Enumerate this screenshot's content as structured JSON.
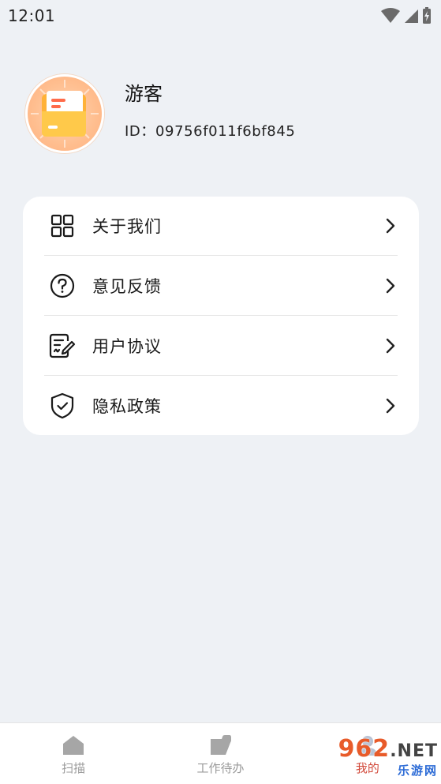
{
  "status_bar": {
    "time": "12:01"
  },
  "profile": {
    "name": "游客",
    "id_label": "ID：09756f011f6bf845"
  },
  "menu": {
    "items": [
      {
        "label": "关于我们",
        "icon": "grid-icon"
      },
      {
        "label": "意见反馈",
        "icon": "question-circle-icon"
      },
      {
        "label": "用户协议",
        "icon": "document-edit-icon"
      },
      {
        "label": "隐私政策",
        "icon": "shield-check-icon"
      }
    ]
  },
  "tab_bar": {
    "tabs": [
      {
        "label": "扫描",
        "icon": "home-icon",
        "active": false
      },
      {
        "label": "工作待办",
        "icon": "task-icon",
        "active": false
      },
      {
        "label": "我的",
        "icon": "person-icon",
        "active": true
      }
    ]
  },
  "watermark": {
    "brand": "962",
    "suffix": ".NET",
    "subtitle": "乐游网"
  },
  "colors": {
    "background": "#eef1f5",
    "card": "#ffffff",
    "tab_active": "#d24a3b",
    "tab_inactive": "#9a9a9a"
  }
}
